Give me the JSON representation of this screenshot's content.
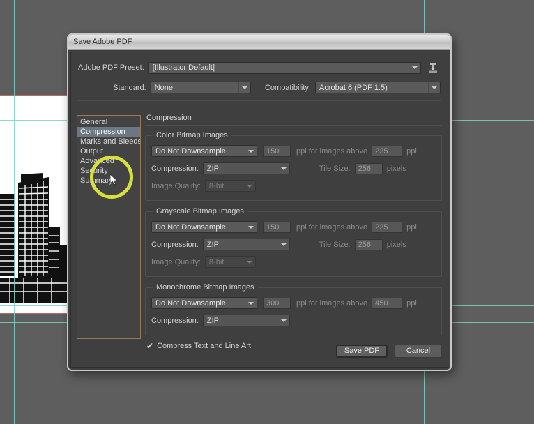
{
  "window": {
    "title": "Save Adobe PDF"
  },
  "top": {
    "preset_label": "Adobe PDF Preset:",
    "preset_value": "[Illustrator Default]",
    "save_preset_icon": "save-preset-icon",
    "standard_label": "Standard:",
    "standard_value": "None",
    "compatibility_label": "Compatibility:",
    "compatibility_value": "Acrobat 6 (PDF 1.5)"
  },
  "sidebar": {
    "items": [
      {
        "label": "General",
        "selected": false
      },
      {
        "label": "Compression",
        "selected": true
      },
      {
        "label": "Marks and Bleeds",
        "selected": false
      },
      {
        "label": "Output",
        "selected": false
      },
      {
        "label": "Advanced",
        "selected": false
      },
      {
        "label": "Security",
        "selected": false
      },
      {
        "label": "Summary",
        "selected": false
      }
    ]
  },
  "panel": {
    "title": "Compression",
    "groups": [
      {
        "legend": "Color Bitmap Images",
        "downsample_value": "Do Not Downsample",
        "ppi_value": "150",
        "ppi_mid_label": "ppi for images above",
        "threshold_value": "225",
        "ppi_unit_label": "ppi",
        "compression_label": "Compression:",
        "compression_value": "ZIP",
        "tile_size_label": "Tile Size:",
        "tile_size_value": "256",
        "tile_unit_label": "pixels",
        "image_quality_label": "Image Quality:",
        "image_quality_value": "8-bit"
      },
      {
        "legend": "Grayscale Bitmap Images",
        "downsample_value": "Do Not Downsample",
        "ppi_value": "150",
        "ppi_mid_label": "ppi for images above",
        "threshold_value": "225",
        "ppi_unit_label": "ppi",
        "compression_label": "Compression:",
        "compression_value": "ZIP",
        "tile_size_label": "Tile Size:",
        "tile_size_value": "256",
        "tile_unit_label": "pixels",
        "image_quality_label": "Image Quality:",
        "image_quality_value": "8-bit"
      },
      {
        "legend": "Monochrome Bitmap Images",
        "downsample_value": "Do Not Downsample",
        "ppi_value": "300",
        "ppi_mid_label": "ppi for images above",
        "threshold_value": "450",
        "ppi_unit_label": "ppi",
        "compression_label": "Compression:",
        "compression_value": "ZIP"
      }
    ],
    "compress_text_checkbox": {
      "label": "Compress Text and Line Art",
      "checked": true,
      "mark": "✔"
    }
  },
  "footer": {
    "save_label": "Save PDF",
    "cancel_label": "Cancel"
  },
  "colors": {
    "dialog_bg": "#3f3f3f",
    "canvas_bg": "#5e5e5e",
    "selection_blue": "#6d7683",
    "focus_border": "#9a7a52",
    "guide_cyan": "#7fd3c0",
    "artboard_edge": "#b26b6b",
    "highlight_yellow": "#d7e03a"
  }
}
